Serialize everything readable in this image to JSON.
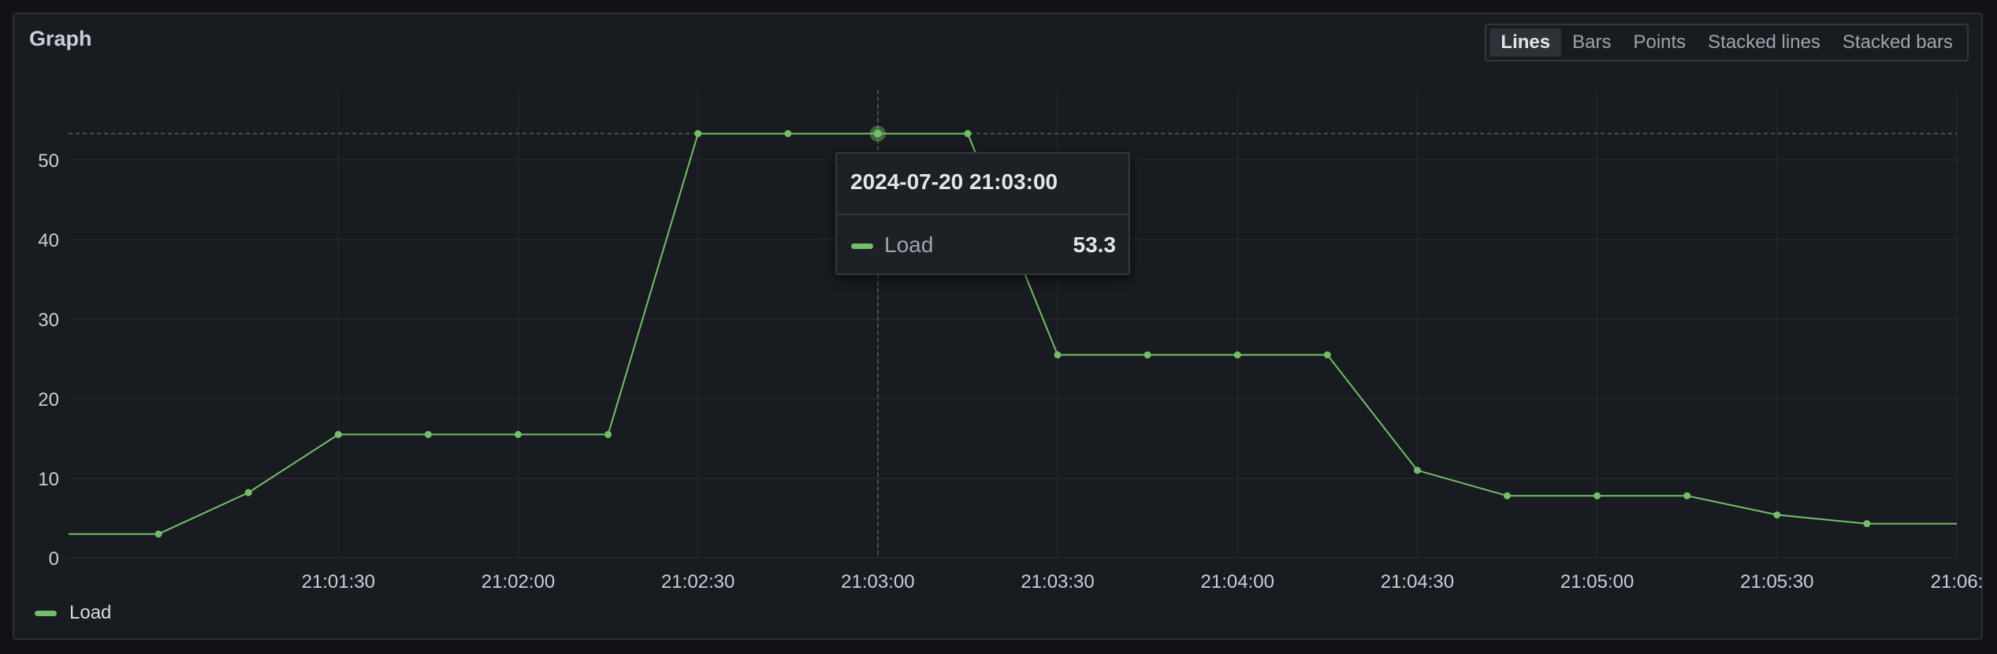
{
  "panel": {
    "title": "Graph"
  },
  "view_modes": [
    {
      "label": "Lines",
      "active": true
    },
    {
      "label": "Bars",
      "active": false
    },
    {
      "label": "Points",
      "active": false
    },
    {
      "label": "Stacked lines",
      "active": false
    },
    {
      "label": "Stacked bars",
      "active": false
    }
  ],
  "tooltip": {
    "time": "2024-07-20 21:03:00",
    "series": "Load",
    "value": "53.3"
  },
  "legend": {
    "label": "Load"
  },
  "colors": {
    "series": "#73bf69",
    "grid": "#2a2c31",
    "axis_text": "#ccccdc"
  },
  "chart_data": {
    "type": "line",
    "title": "Graph",
    "x": [
      "21:00:45",
      "21:01:00",
      "21:01:15",
      "21:01:30",
      "21:01:45",
      "21:02:00",
      "21:02:15",
      "21:02:30",
      "21:02:45",
      "21:03:00",
      "21:03:15",
      "21:03:30",
      "21:03:45",
      "21:04:00",
      "21:04:15",
      "21:04:30",
      "21:04:45",
      "21:05:00",
      "21:05:15",
      "21:05:30",
      "21:05:45",
      "21:06:00"
    ],
    "series": [
      {
        "name": "Load",
        "values": [
          3.0,
          3.0,
          8.2,
          15.5,
          15.5,
          15.5,
          15.5,
          53.3,
          53.3,
          53.3,
          53.3,
          25.5,
          25.5,
          25.5,
          25.5,
          11.0,
          7.8,
          7.8,
          7.8,
          5.4,
          4.3,
          4.3
        ]
      }
    ],
    "x_tick_labels": [
      "21:01:30",
      "21:02:00",
      "21:02:30",
      "21:03:00",
      "21:03:30",
      "21:04:00",
      "21:04:30",
      "21:05:00",
      "21:05:30",
      "21:06:"
    ],
    "y_ticks": [
      0,
      10,
      20,
      30,
      40,
      50
    ],
    "ylim": [
      0,
      58.8
    ],
    "hover": {
      "x": "21:03:00",
      "value": 53.3
    },
    "grid": true,
    "legend_position": "bottom-left"
  }
}
